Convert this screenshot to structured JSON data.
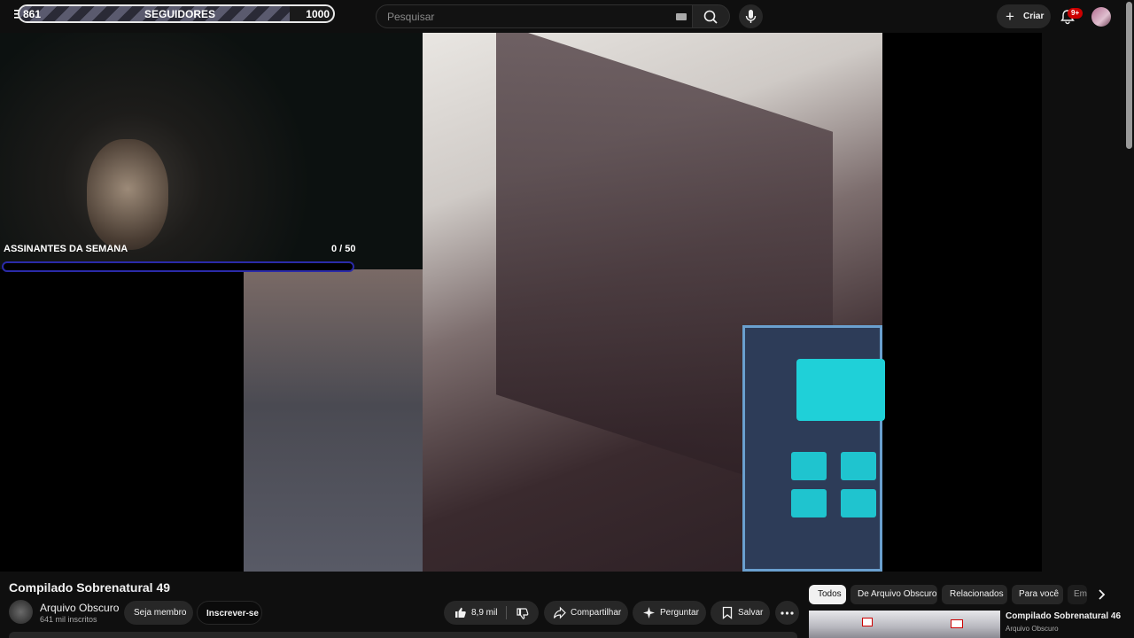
{
  "overlay": {
    "followers": {
      "current": "861",
      "label": "SEGUIDORES",
      "goal": "1000",
      "progress": 0.861
    },
    "subs_goal": {
      "label": "ASSINANTES DA SEMANA",
      "count": "0 / 50",
      "progress": 0
    }
  },
  "header": {
    "search_placeholder": "Pesquisar",
    "create_label": "Criar",
    "notifications_badge": "9+"
  },
  "video": {
    "title": "Compilado Sobrenatural 49",
    "channel": "Arquivo Obscuro",
    "subscribers": "641 mil inscritos",
    "join_label": "Seja membro",
    "subscribe_label": "Inscrever-se",
    "likes": "8,9 mil",
    "share_label": "Compartilhar",
    "ask_label": "Perguntar",
    "save_label": "Salvar"
  },
  "chips": [
    "Todos",
    "De Arquivo Obscuro",
    "Relacionados",
    "Para você",
    "Em"
  ],
  "recommended": [
    {
      "title": "Compilado Sobrenatural 46",
      "channel": "Arquivo Obscuro"
    }
  ],
  "colors": {
    "background": "#0f0f0f",
    "pill": "#272727",
    "notification": "#cc0000",
    "goal_bar_border": "#2a2aa8"
  }
}
